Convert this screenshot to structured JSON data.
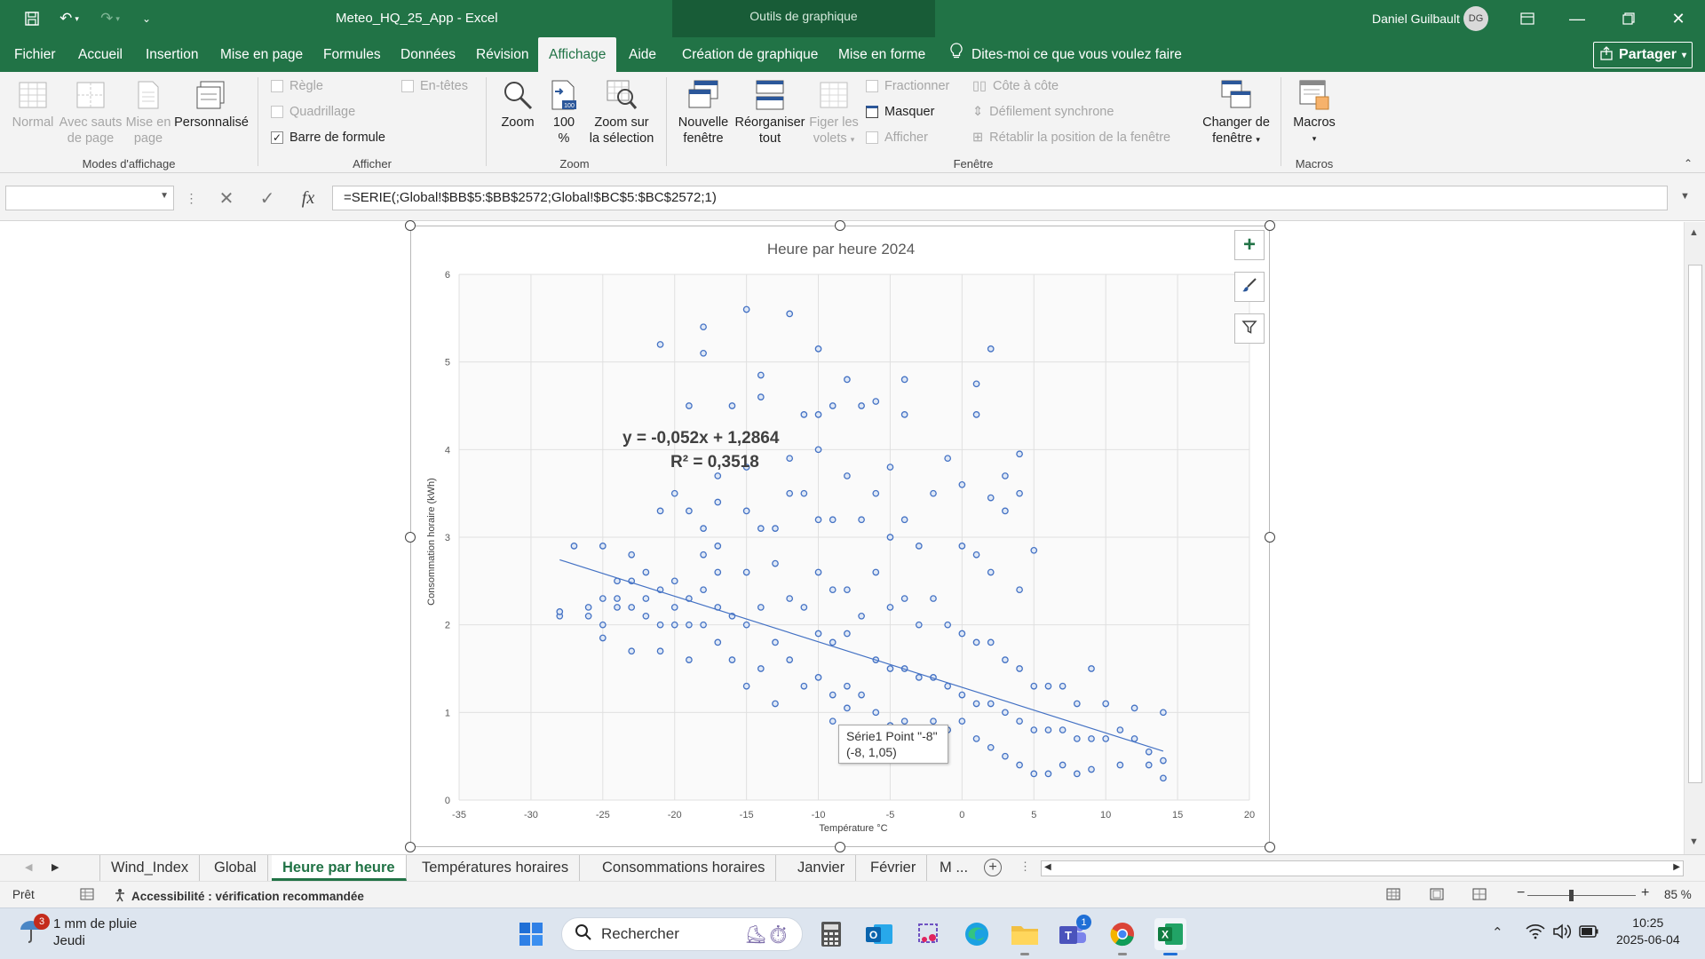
{
  "window": {
    "doc_title": "Meteo_HQ_25_App  -  Excel",
    "tools_context": "Outils de graphique",
    "user_name": "Daniel Guilbault",
    "user_initials": "DG"
  },
  "ribbon_tabs": [
    "Fichier",
    "Accueil",
    "Insertion",
    "Mise en page",
    "Formules",
    "Données",
    "Révision",
    "Affichage",
    "Aide",
    "Création de graphique",
    "Mise en forme"
  ],
  "active_tab": "Affichage",
  "tell_me": "Dites-moi ce que vous voulez faire",
  "share": "Partager",
  "ribbon": {
    "modes": {
      "normal": "Normal",
      "page_breaks_1": "Avec sauts",
      "page_breaks_2": "de page",
      "page_layout_1": "Mise en",
      "page_layout_2": "page",
      "custom": "Personnalisé",
      "label": "Modes d'affichage"
    },
    "show": {
      "ruler": "Règle",
      "gridlines": "Quadrillage",
      "formula_bar": "Barre de formule",
      "headings": "En-têtes",
      "label": "Afficher"
    },
    "zoom": {
      "zoom": "Zoom",
      "hundred_1": "100",
      "hundred_2": "%",
      "zoom_sel_1": "Zoom sur",
      "zoom_sel_2": "la sélection",
      "label": "Zoom"
    },
    "window": {
      "new_1": "Nouvelle",
      "new_2": "fenêtre",
      "arrange_1": "Réorganiser",
      "arrange_2": "tout",
      "freeze_1": "Figer les",
      "freeze_2": "volets",
      "split": "Fractionner",
      "hide": "Masquer",
      "unhide": "Afficher",
      "side": "Côte à côte",
      "sync": "Défilement synchrone",
      "reset": "Rétablir la position de la fenêtre",
      "switch_1": "Changer de",
      "switch_2": "fenêtre",
      "label": "Fenêtre"
    },
    "macros": {
      "btn": "Macros",
      "label": "Macros"
    }
  },
  "formula_bar": {
    "name_box": "",
    "formula": "=SERIE(;Global!$BB$5:$BB$2572;Global!$BC$5:$BC$2572;1)"
  },
  "chart_data": {
    "type": "scatter",
    "title": "Heure par heure 2024",
    "xlabel": "Température °C",
    "ylabel": "Consommation horaire (kWh)",
    "xlim": [
      -35,
      20
    ],
    "ylim": [
      0,
      6
    ],
    "xticks": [
      -35,
      -30,
      -25,
      -20,
      -15,
      -10,
      -5,
      0,
      5,
      10,
      15,
      20
    ],
    "yticks": [
      0,
      1,
      2,
      3,
      4,
      5,
      6
    ],
    "grid": true,
    "marker_color": "#4472c4",
    "trendline": {
      "type": "linear",
      "slope": -0.052,
      "intercept": 1.2864,
      "x_range": [
        -28,
        14
      ],
      "equation_label": "y = -0,052x + 1,2864",
      "r2_label": "R² = 0,3518"
    },
    "series": [
      {
        "values_note": "",
        "points": [
          [
            -28,
            2.1
          ],
          [
            -28,
            2.15
          ],
          [
            -27,
            2.9
          ],
          [
            -26,
            2.2
          ],
          [
            -26,
            2.1
          ],
          [
            -25,
            2.0
          ],
          [
            -25,
            2.3
          ],
          [
            -25,
            1.85
          ],
          [
            -25,
            2.9
          ],
          [
            -24,
            2.2
          ],
          [
            -24,
            2.3
          ],
          [
            -24,
            2.5
          ],
          [
            -23,
            2.2
          ],
          [
            -23,
            2.5
          ],
          [
            -23,
            1.7
          ],
          [
            -23,
            2.8
          ],
          [
            -22,
            2.1
          ],
          [
            -22,
            2.3
          ],
          [
            -22,
            2.6
          ],
          [
            -21,
            1.7
          ],
          [
            -21,
            2.0
          ],
          [
            -21,
            2.4
          ],
          [
            -21,
            3.3
          ],
          [
            -21,
            5.2
          ],
          [
            -20,
            2.0
          ],
          [
            -20,
            2.2
          ],
          [
            -20,
            2.5
          ],
          [
            -20,
            3.5
          ],
          [
            -19,
            1.6
          ],
          [
            -19,
            2.0
          ],
          [
            -19,
            2.3
          ],
          [
            -19,
            3.3
          ],
          [
            -19,
            4.5
          ],
          [
            -18,
            2.0
          ],
          [
            -18,
            2.4
          ],
          [
            -18,
            2.8
          ],
          [
            -18,
            3.1
          ],
          [
            -18,
            5.1
          ],
          [
            -18,
            5.4
          ],
          [
            -17,
            1.8
          ],
          [
            -17,
            2.2
          ],
          [
            -17,
            2.6
          ],
          [
            -17,
            2.9
          ],
          [
            -17,
            3.4
          ],
          [
            -17,
            3.7
          ],
          [
            -16,
            1.6
          ],
          [
            -16,
            2.1
          ],
          [
            -16,
            4.5
          ],
          [
            -15,
            1.3
          ],
          [
            -15,
            2.0
          ],
          [
            -15,
            2.6
          ],
          [
            -15,
            3.3
          ],
          [
            -15,
            3.8
          ],
          [
            -15,
            5.6
          ],
          [
            -14,
            1.5
          ],
          [
            -14,
            2.2
          ],
          [
            -14,
            3.1
          ],
          [
            -14,
            4.6
          ],
          [
            -14,
            4.85
          ],
          [
            -13,
            1.1
          ],
          [
            -13,
            1.8
          ],
          [
            -13,
            2.7
          ],
          [
            -13,
            3.1
          ],
          [
            -12,
            1.6
          ],
          [
            -12,
            2.3
          ],
          [
            -12,
            3.5
          ],
          [
            -12,
            3.9
          ],
          [
            -12,
            5.55
          ],
          [
            -11,
            1.3
          ],
          [
            -11,
            2.2
          ],
          [
            -11,
            3.5
          ],
          [
            -11,
            4.4
          ],
          [
            -10,
            1.4
          ],
          [
            -10,
            1.9
          ],
          [
            -10,
            2.6
          ],
          [
            -10,
            3.2
          ],
          [
            -10,
            4.4
          ],
          [
            -10,
            4.0
          ],
          [
            -10,
            5.15
          ],
          [
            -9,
            1.2
          ],
          [
            -9,
            1.8
          ],
          [
            -9,
            2.4
          ],
          [
            -9,
            3.2
          ],
          [
            -9,
            0.9
          ],
          [
            -9,
            4.5
          ],
          [
            -8,
            1.3
          ],
          [
            -8,
            1.9
          ],
          [
            -8,
            2.4
          ],
          [
            -8,
            3.7
          ],
          [
            -8,
            4.8
          ],
          [
            -8,
            1.05
          ],
          [
            -7,
            1.2
          ],
          [
            -7,
            2.1
          ],
          [
            -7,
            3.2
          ],
          [
            -7,
            4.5
          ],
          [
            -6,
            1.0
          ],
          [
            -6,
            1.6
          ],
          [
            -6,
            2.6
          ],
          [
            -6,
            3.5
          ],
          [
            -6,
            4.55
          ],
          [
            -5,
            0.85
          ],
          [
            -5,
            1.5
          ],
          [
            -5,
            2.2
          ],
          [
            -5,
            3.0
          ],
          [
            -5,
            3.8
          ],
          [
            -4,
            0.9
          ],
          [
            -4,
            1.5
          ],
          [
            -4,
            2.3
          ],
          [
            -4,
            3.2
          ],
          [
            -4,
            4.8
          ],
          [
            -4,
            4.4
          ],
          [
            -3,
            0.8
          ],
          [
            -3,
            1.4
          ],
          [
            -3,
            2.0
          ],
          [
            -3,
            2.9
          ],
          [
            -2,
            0.9
          ],
          [
            -2,
            1.4
          ],
          [
            -2,
            2.3
          ],
          [
            -2,
            3.5
          ],
          [
            -1,
            0.8
          ],
          [
            -1,
            1.3
          ],
          [
            -1,
            2.0
          ],
          [
            -1,
            3.9
          ],
          [
            0,
            0.9
          ],
          [
            0,
            1.2
          ],
          [
            0,
            1.9
          ],
          [
            0,
            2.9
          ],
          [
            0,
            3.6
          ],
          [
            1,
            0.7
          ],
          [
            1,
            1.1
          ],
          [
            1,
            1.8
          ],
          [
            1,
            2.8
          ],
          [
            1,
            4.4
          ],
          [
            1,
            4.75
          ],
          [
            2,
            0.6
          ],
          [
            2,
            1.1
          ],
          [
            2,
            1.8
          ],
          [
            2,
            2.6
          ],
          [
            2,
            3.45
          ],
          [
            2,
            5.15
          ],
          [
            3,
            0.5
          ],
          [
            3,
            1.0
          ],
          [
            3,
            1.6
          ],
          [
            3,
            3.3
          ],
          [
            3,
            3.7
          ],
          [
            4,
            0.4
          ],
          [
            4,
            0.9
          ],
          [
            4,
            1.5
          ],
          [
            4,
            2.4
          ],
          [
            4,
            3.5
          ],
          [
            4,
            3.95
          ],
          [
            5,
            0.3
          ],
          [
            5,
            0.8
          ],
          [
            5,
            1.3
          ],
          [
            5,
            2.85
          ],
          [
            6,
            0.3
          ],
          [
            6,
            0.8
          ],
          [
            6,
            1.3
          ],
          [
            7,
            0.4
          ],
          [
            7,
            0.8
          ],
          [
            7,
            1.3
          ],
          [
            8,
            0.3
          ],
          [
            8,
            0.7
          ],
          [
            8,
            1.1
          ],
          [
            9,
            0.35
          ],
          [
            9,
            0.7
          ],
          [
            9,
            1.5
          ],
          [
            10,
            0.7
          ],
          [
            10,
            1.1
          ],
          [
            11,
            0.4
          ],
          [
            11,
            0.8
          ],
          [
            12,
            1.05
          ],
          [
            12,
            0.7
          ],
          [
            13,
            0.4
          ],
          [
            13,
            0.55
          ],
          [
            14,
            0.25
          ],
          [
            14,
            0.45
          ],
          [
            14,
            1.0
          ]
        ]
      }
    ],
    "tooltip": {
      "line1": "Série1 Point \"-8\"",
      "line2": "(-8, 1,05)"
    }
  },
  "sheet_tabs": [
    "Wind_Index",
    "Global",
    "Heure par heure",
    "Températures horaires",
    "Consommations horaires",
    "Janvier",
    "Février",
    "M ..."
  ],
  "active_sheet": "Heure par heure",
  "status": {
    "ready": "Prêt",
    "accessibility": "Accessibilité : vérification recommandée",
    "zoom": "85 %"
  },
  "taskbar": {
    "weather_line1": "1 mm de pluie",
    "weather_line2": "Jeudi",
    "weather_badge": "3",
    "search": "Rechercher",
    "teams_badge": "1",
    "time": "10:25",
    "date": "2025-06-04"
  }
}
